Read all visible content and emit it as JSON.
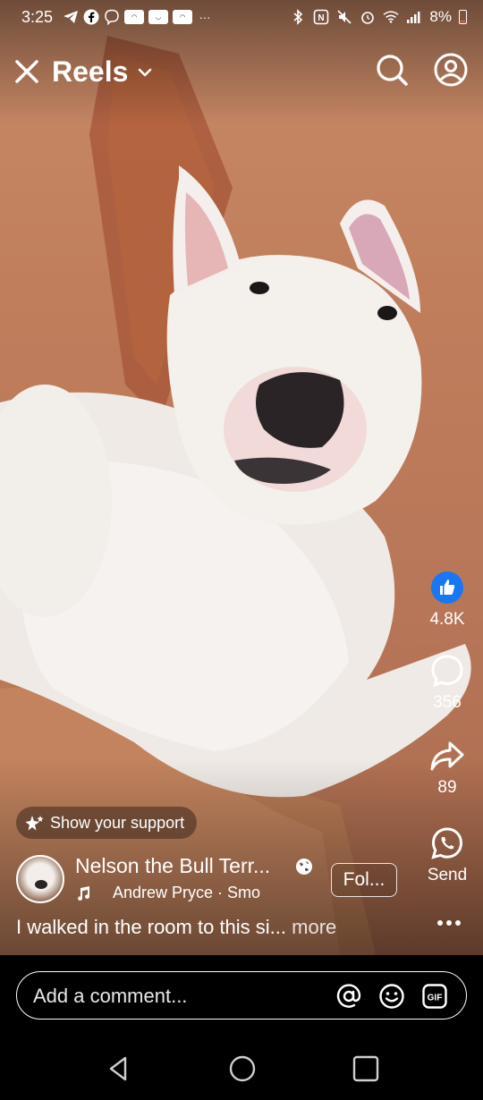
{
  "status_bar": {
    "time": "3:25",
    "battery": "8%",
    "left_icons": [
      "telegram-icon",
      "facebook-icon",
      "viber-icon",
      "temu-icon",
      "temu-icon",
      "temu-icon",
      "more-icon"
    ],
    "right_icons": [
      "bluetooth-icon",
      "nfc-icon",
      "mute-icon",
      "alarm-icon",
      "wifi-icon",
      "signal-icon",
      "battery-icon"
    ]
  },
  "header": {
    "title": "Reels",
    "icons": [
      "close-icon",
      "chevron-down-icon",
      "search-icon",
      "profile-icon"
    ]
  },
  "actions": {
    "like_count": "4.8K",
    "comment_count": "356",
    "share_count": "89",
    "send_label": "Send"
  },
  "post": {
    "support_label": "Show your support",
    "page_name": "Nelson the Bull Terr...",
    "follow_label": "Fol...",
    "music_text": "Andrew Pryce · Smo",
    "caption": "I walked in the room to this si...",
    "more_label": "more"
  },
  "comment_bar": {
    "placeholder": "Add a comment..."
  },
  "colors": {
    "like_blue": "#1877f2",
    "background": "#000000"
  }
}
